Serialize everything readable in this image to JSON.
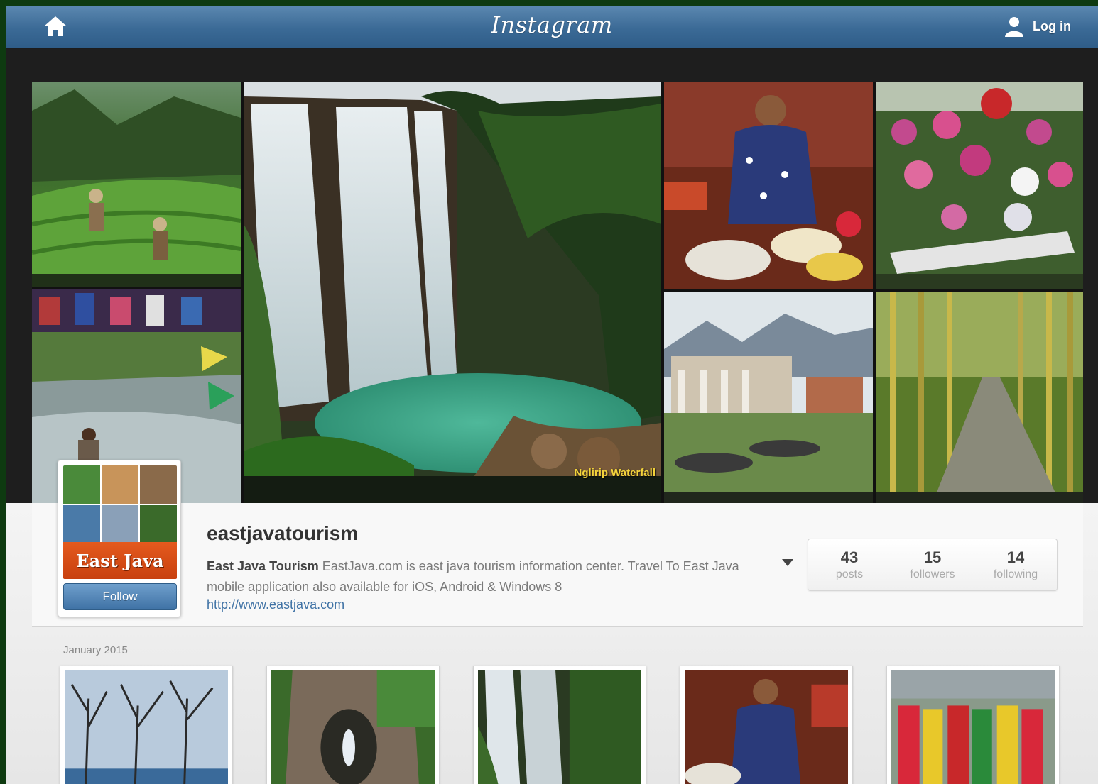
{
  "header": {
    "home_icon": "home-icon",
    "brand": "Instagram",
    "login_icon": "user-icon",
    "login_label": "Log in"
  },
  "collage": {
    "tiles": [
      {
        "subject": "tea plantation workers",
        "accent": "#3f7a2a"
      },
      {
        "subject": "waterfall",
        "accent": "#2e9c7a"
      },
      {
        "subject": "market vendor",
        "accent": "#b33a2a"
      },
      {
        "subject": "flower nursery",
        "accent": "#c2508e"
      },
      {
        "subject": "river washing",
        "accent": "#4b7c3a"
      },
      {
        "subject": "colonial house",
        "accent": "#6e8c5a"
      },
      {
        "subject": "bamboo path",
        "accent": "#8a9a3a"
      }
    ],
    "waterfall_caption": "Nglirip Waterfall"
  },
  "profile": {
    "avatar_banner": "East Java",
    "follow_label": "Follow",
    "username": "eastjavatourism",
    "full_name": "East Java Tourism",
    "bio": "EastJava.com is east java tourism information center. Travel To East Java mobile application also available for iOS, Android & Windows 8",
    "link": "http://www.eastjava.com",
    "stats": [
      {
        "value": "43",
        "label": "posts"
      },
      {
        "value": "15",
        "label": "followers"
      },
      {
        "value": "14",
        "label": "following"
      }
    ]
  },
  "timeline": {
    "month_label": "January 2015",
    "thumbs": [
      {
        "subject": "bare trees by the sea"
      },
      {
        "subject": "grotto statue"
      },
      {
        "subject": "waterfall"
      },
      {
        "subject": "market vendor"
      },
      {
        "subject": "traditional dancers"
      }
    ]
  },
  "colors": {
    "header_blue": "#3b6a96",
    "follow_blue": "#3f72a5",
    "avatar_orange": "#d84a15",
    "caption_yellow": "#f3d33b",
    "frame_green": "#0e3a10"
  }
}
